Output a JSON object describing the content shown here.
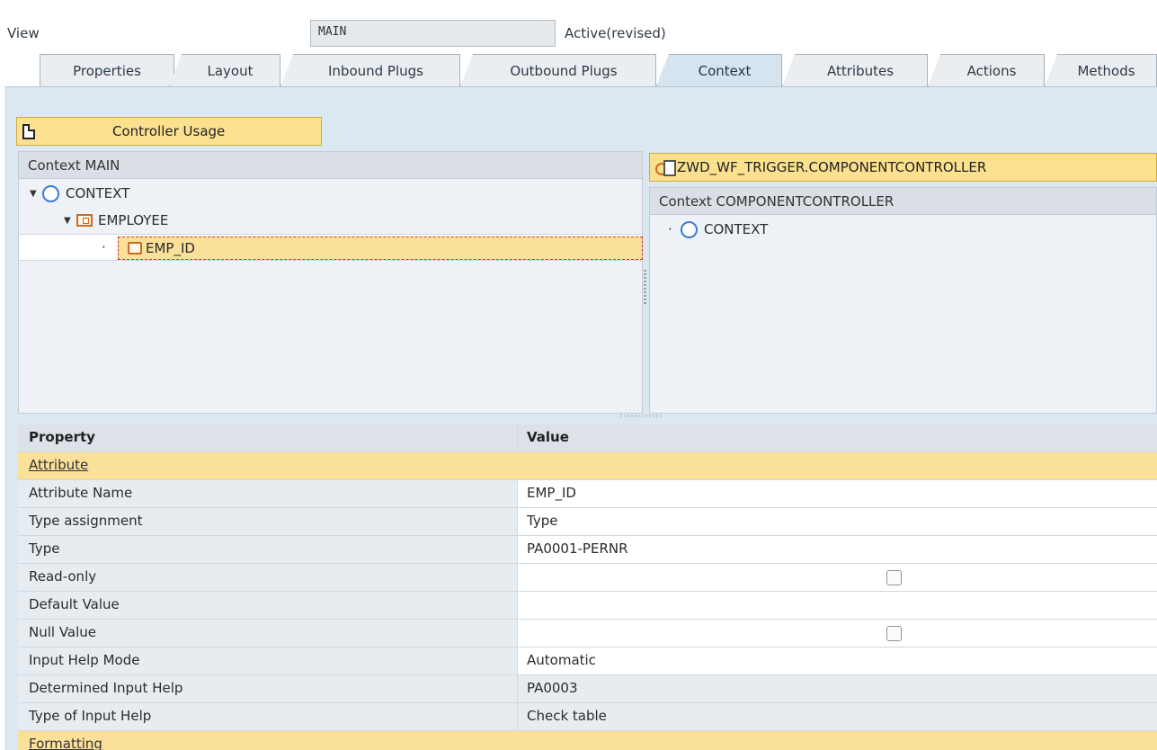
{
  "header": {
    "view_label": "View",
    "view_name": "MAIN",
    "status": "Active(revised)"
  },
  "tabs": [
    {
      "label": "Properties",
      "active": false
    },
    {
      "label": "Layout",
      "active": false
    },
    {
      "label": "Inbound Plugs",
      "active": false
    },
    {
      "label": "Outbound Plugs",
      "active": false
    },
    {
      "label": "Context",
      "active": true
    },
    {
      "label": "Attributes",
      "active": false
    },
    {
      "label": "Actions",
      "active": false
    },
    {
      "label": "Methods",
      "active": false
    }
  ],
  "toolbar": {
    "controller_usage_label": "Controller Usage"
  },
  "left_tree": {
    "title": "Context MAIN",
    "root": "CONTEXT",
    "node": "EMPLOYEE",
    "selected_attribute": "EMP_ID"
  },
  "right_tree": {
    "controller_button": "ZWD_WF_TRIGGER.COMPONENTCONTROLLER",
    "title": "Context COMPONENTCONTROLLER",
    "root": "CONTEXT"
  },
  "properties": {
    "header_property": "Property",
    "header_value": "Value",
    "group_attribute": "Attribute",
    "rows": [
      {
        "name": "Attribute Name",
        "value": "EMP_ID"
      },
      {
        "name": "Type assignment",
        "value": "Type"
      },
      {
        "name": "Type",
        "value": "PA0001-PERNR"
      },
      {
        "name": "Read-only",
        "value": ""
      },
      {
        "name": "Default Value",
        "value": ""
      },
      {
        "name": "Null Value",
        "value": ""
      },
      {
        "name": "Input Help Mode",
        "value": "Automatic"
      },
      {
        "name": "Determined Input Help",
        "value": "PA0003"
      },
      {
        "name": "Type of Input Help",
        "value": "Check table"
      }
    ],
    "group_formatting": "Formatting"
  },
  "colors": {
    "accent_yellow": "#fbe18f",
    "selection": "#fbe09a",
    "tab_active": "#d6e4ef",
    "panel_bg": "#dbe8f2"
  }
}
